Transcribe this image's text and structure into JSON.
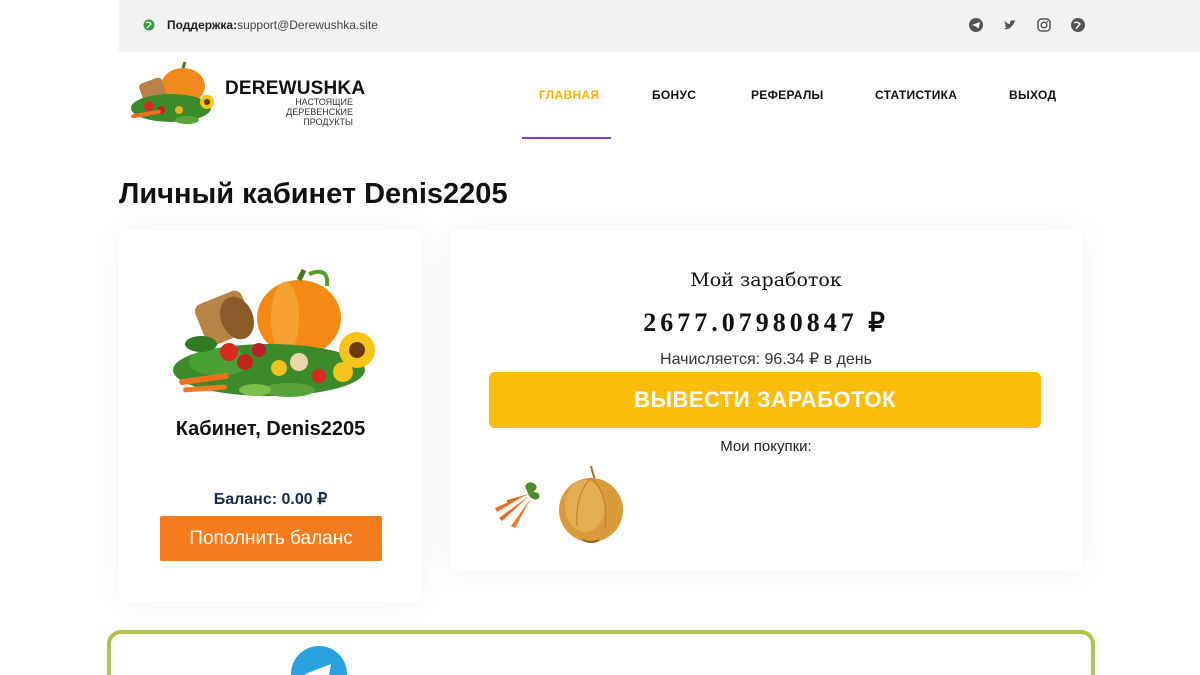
{
  "topbar": {
    "support_label": "Поддержка:",
    "support_email": "support@Derewushka.site",
    "icons": [
      "telegram-icon",
      "twitter-icon",
      "instagram-icon",
      "globe-icon"
    ]
  },
  "brand": {
    "name": "DEREWUSHKA",
    "tagline": "НАСТОЯЩИЕ ДЕРЕВЕНСКИЕ ПРОДУКТЫ"
  },
  "nav": {
    "items": [
      {
        "label": "ГЛАВНАЯ",
        "active": true
      },
      {
        "label": "БОНУС",
        "active": false
      },
      {
        "label": "РЕФЕРАЛЫ",
        "active": false
      },
      {
        "label": "СТАТИСТИКА",
        "active": false
      },
      {
        "label": "ВЫХОД",
        "active": false
      }
    ]
  },
  "page": {
    "title": "Личный кабинет Denis2205"
  },
  "profile": {
    "cabinet_title": "Кабинет, Denis2205",
    "balance": "Баланс: 0.00 ₽",
    "topup_label": "Пополнить баланс"
  },
  "earnings": {
    "label": "Мой заработок",
    "amount": "2677.07980847 ₽",
    "accrual": "Начисляется: 96.34 ₽ в день",
    "withdraw_label": "ВЫВЕСТИ ЗАРАБОТОК",
    "purchases_label": "Мои покупки:",
    "purchases": [
      "carrot",
      "onion"
    ]
  },
  "colors": {
    "accent_nav": "#f1b400",
    "nav_underline": "#7a3fb8",
    "topup_button": "#f57c1c",
    "withdraw_button": "#fdbd0b",
    "bottom_border": "#b5c04f",
    "telegram": "#2aa1df"
  }
}
